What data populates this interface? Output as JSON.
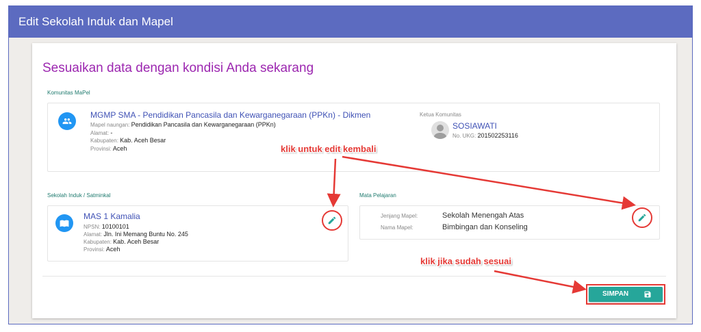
{
  "window": {
    "title": "Edit Sekolah Induk dan Mapel"
  },
  "page": {
    "heading": "Sesuaikan data dengan kondisi Anda sekarang"
  },
  "komunitas": {
    "section_label": "Komunitas MaPel",
    "icon": "group-icon",
    "name": "MGMP SMA - Pendidikan Pancasila dan Kewarganegaraan (PPKn) - Dikmen",
    "mapel_label": "Mapel naungan:",
    "mapel_value": "Pendidikan Pancasila dan Kewarganegaraan (PPKn)",
    "alamat_label": "Alamat:",
    "alamat_value": "-",
    "kabupaten_label": "Kabupaten:",
    "kabupaten_value": "Kab. Aceh Besar",
    "provinsi_label": "Provinsi:",
    "provinsi_value": "Aceh",
    "ketua_label": "Ketua Komunitas",
    "ketua_name": "SOSIAWATI",
    "ukg_label": "No. UKG:",
    "ukg_value": "201502253116"
  },
  "sekolah": {
    "section_label": "Sekolah Induk / Satminkal",
    "icon": "school-icon",
    "name": "MAS 1 Kamalia",
    "npsn_label": "NPSN:",
    "npsn_value": "10100101",
    "alamat_label": "Alamat:",
    "alamat_value": "Jln. Ini Memang Buntu No. 245",
    "kabupaten_label": "Kabupaten:",
    "kabupaten_value": "Kab. Aceh Besar",
    "provinsi_label": "Provinsi:",
    "provinsi_value": "Aceh",
    "edit_icon": "pencil-icon"
  },
  "mapel": {
    "section_label": "Mata Pelajaran",
    "jenjang_label": "Jenjang Mapel:",
    "jenjang_value": "Sekolah Menengah Atas",
    "nama_label": "Nama Mapel:",
    "nama_value": "Bimbingan dan Konseling",
    "edit_icon": "pencil-icon"
  },
  "actions": {
    "save_label": "SIMPAN",
    "save_icon": "floppy-disk-icon"
  },
  "annotations": {
    "edit_hint": "klik untuk edit kembali",
    "save_hint": "klik jika sudah sesuai"
  },
  "colors": {
    "titlebar": "#5c6bc0",
    "heading": "#9c27b0",
    "primary": "#3f51b5",
    "accent_teal": "#26a69a",
    "annotation_red": "#e53935",
    "icon_blue": "#2196f3"
  }
}
